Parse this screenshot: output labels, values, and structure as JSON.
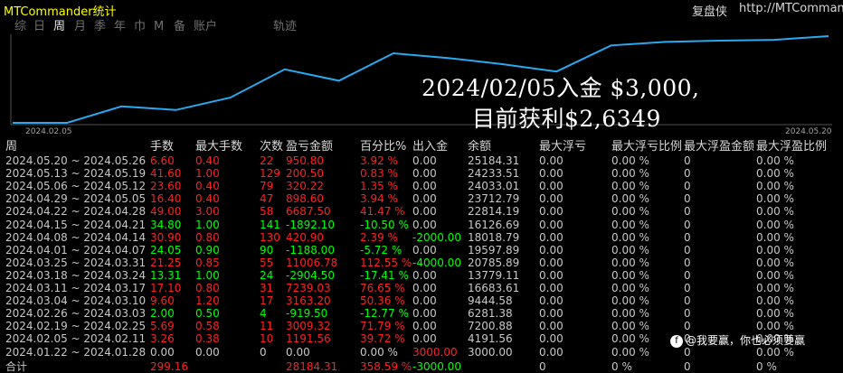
{
  "app": {
    "title": "MTCommander统计",
    "site_name": "复盘侠",
    "site_url": "http://MTCommands"
  },
  "periods": [
    {
      "label": "综",
      "active": false
    },
    {
      "label": "日",
      "active": false
    },
    {
      "label": "周",
      "active": true
    },
    {
      "label": "月",
      "active": false
    },
    {
      "label": "季",
      "active": false
    },
    {
      "label": "年",
      "active": false
    },
    {
      "label": "巾",
      "active": false
    },
    {
      "label": "M",
      "active": false
    },
    {
      "label": "备",
      "active": false
    },
    {
      "label": "账户",
      "active": false
    },
    {
      "label": "轨迹",
      "active": false
    }
  ],
  "overlay": {
    "line1": "2024/02/05入金 $3,000,",
    "line2": "目前获利$2,6349"
  },
  "chart_data": {
    "type": "line",
    "x_labels": [
      "2024.02.05",
      "2024.05.20"
    ],
    "series": [
      {
        "values": [
          3000,
          3000,
          7200.88,
          6281.38,
          9444.58,
          16683.61,
          13779.11,
          20785.89,
          19597.89,
          18018.79,
          16126.69,
          22814.19,
          23712.79,
          24033.01,
          24233.51,
          25184.31
        ]
      }
    ],
    "colors": {
      "line": "#29a9f0",
      "grid": "#2a2a2a",
      "axis": "#505050"
    }
  },
  "table": {
    "headers": [
      "周",
      "手数",
      "最大手数",
      "次数",
      "盈亏金额",
      "百分比%",
      "出入金",
      "余额",
      "最大浮亏",
      "最大浮亏比例",
      "最大浮盈金额",
      "最大浮盈比例"
    ],
    "rows": [
      {
        "period": "2024.05.20 ~ 2024.05.26",
        "lots": "6.60",
        "max_lots": "0.40",
        "count": "22",
        "pnl": "950.80",
        "pct": "3.92 %",
        "flow": "0.00",
        "balance": "25184.31",
        "max_float_loss": "0.00",
        "max_float_loss_pct": "0.00 %",
        "max_float_profit": "0",
        "max_float_profit_pct": "0.00 %",
        "sign": "pos"
      },
      {
        "period": "2024.05.13 ~ 2024.05.19",
        "lots": "41.60",
        "max_lots": "1.00",
        "count": "129",
        "pnl": "200.50",
        "pct": "0.83 %",
        "flow": "0.00",
        "balance": "24233.51",
        "max_float_loss": "0.00",
        "max_float_loss_pct": "0.00 %",
        "max_float_profit": "0",
        "max_float_profit_pct": "0.00 %",
        "sign": "pos"
      },
      {
        "period": "2024.05.06 ~ 2024.05.12",
        "lots": "23.60",
        "max_lots": "0.40",
        "count": "79",
        "pnl": "320.22",
        "pct": "1.35 %",
        "flow": "0.00",
        "balance": "24033.01",
        "max_float_loss": "0.00",
        "max_float_loss_pct": "0.00 %",
        "max_float_profit": "0",
        "max_float_profit_pct": "0.00 %",
        "sign": "pos"
      },
      {
        "period": "2024.04.29 ~ 2024.05.05",
        "lots": "16.40",
        "max_lots": "0.40",
        "count": "47",
        "pnl": "898.60",
        "pct": "3.94 %",
        "flow": "0.00",
        "balance": "23712.79",
        "max_float_loss": "0.00",
        "max_float_loss_pct": "0.00 %",
        "max_float_profit": "0",
        "max_float_profit_pct": "0.00 %",
        "sign": "pos"
      },
      {
        "period": "2024.04.22 ~ 2024.04.28",
        "lots": "49.00",
        "max_lots": "3.00",
        "count": "58",
        "pnl": "6687.50",
        "pct": "41.47 %",
        "flow": "0.00",
        "balance": "22814.19",
        "max_float_loss": "0.00",
        "max_float_loss_pct": "0.00 %",
        "max_float_profit": "0",
        "max_float_profit_pct": "0.00 %",
        "sign": "pos"
      },
      {
        "period": "2024.04.15 ~ 2024.04.21",
        "lots": "34.80",
        "max_lots": "1.00",
        "count": "141",
        "pnl": "-1892.10",
        "pct": "-10.50 %",
        "flow": "0.00",
        "balance": "16126.69",
        "max_float_loss": "0.00",
        "max_float_loss_pct": "0.00 %",
        "max_float_profit": "0",
        "max_float_profit_pct": "0.00 %",
        "sign": "neg"
      },
      {
        "period": "2024.04.08 ~ 2024.04.14",
        "lots": "30.90",
        "max_lots": "0.80",
        "count": "130",
        "pnl": "420.90",
        "pct": "2.39 %",
        "flow": "-2000.00",
        "balance": "18018.79",
        "max_float_loss": "0.00",
        "max_float_loss_pct": "0.00 %",
        "max_float_profit": "0",
        "max_float_profit_pct": "0.00 %",
        "sign": "pos"
      },
      {
        "period": "2024.04.01 ~ 2024.04.07",
        "lots": "24.05",
        "max_lots": "0.90",
        "count": "90",
        "pnl": "-1188.00",
        "pct": "-5.72 %",
        "flow": "0.00",
        "balance": "19597.89",
        "max_float_loss": "0.00",
        "max_float_loss_pct": "0.00 %",
        "max_float_profit": "0",
        "max_float_profit_pct": "0.00 %",
        "sign": "neg"
      },
      {
        "period": "2024.03.25 ~ 2024.03.31",
        "lots": "21.25",
        "max_lots": "0.85",
        "count": "55",
        "pnl": "11006.78",
        "pct": "112.55 %",
        "flow": "-4000.00",
        "balance": "20785.89",
        "max_float_loss": "0.00",
        "max_float_loss_pct": "0.00 %",
        "max_float_profit": "0",
        "max_float_profit_pct": "0.00 %",
        "sign": "pos"
      },
      {
        "period": "2024.03.18 ~ 2024.03.24",
        "lots": "13.31",
        "max_lots": "1.00",
        "count": "24",
        "pnl": "-2904.50",
        "pct": "-17.41 %",
        "flow": "0.00",
        "balance": "13779.11",
        "max_float_loss": "0.00",
        "max_float_loss_pct": "0.00 %",
        "max_float_profit": "0",
        "max_float_profit_pct": "0.00 %",
        "sign": "neg"
      },
      {
        "period": "2024.03.11 ~ 2024.03.17",
        "lots": "17.10",
        "max_lots": "0.80",
        "count": "31",
        "pnl": "7239.03",
        "pct": "76.65 %",
        "flow": "0.00",
        "balance": "16683.61",
        "max_float_loss": "0.00",
        "max_float_loss_pct": "0.00 %",
        "max_float_profit": "0",
        "max_float_profit_pct": "0.00 %",
        "sign": "pos"
      },
      {
        "period": "2024.03.04 ~ 2024.03.10",
        "lots": "9.60",
        "max_lots": "1.20",
        "count": "17",
        "pnl": "3163.20",
        "pct": "50.36 %",
        "flow": "0.00",
        "balance": "9444.58",
        "max_float_loss": "0.00",
        "max_float_loss_pct": "0.00 %",
        "max_float_profit": "0",
        "max_float_profit_pct": "0.00 %",
        "sign": "pos"
      },
      {
        "period": "2024.02.26 ~ 2024.03.03",
        "lots": "2.00",
        "max_lots": "0.50",
        "count": "4",
        "pnl": "-919.50",
        "pct": "-12.77 %",
        "flow": "0.00",
        "balance": "6281.38",
        "max_float_loss": "0.00",
        "max_float_loss_pct": "0.00 %",
        "max_float_profit": "0",
        "max_float_profit_pct": "0.00 %",
        "sign": "neg"
      },
      {
        "period": "2024.02.19 ~ 2024.02.25",
        "lots": "5.69",
        "max_lots": "0.58",
        "count": "11",
        "pnl": "3009.32",
        "pct": "71.79 %",
        "flow": "0.00",
        "balance": "7200.88",
        "max_float_loss": "0.00",
        "max_float_loss_pct": "0.00 %",
        "max_float_profit": "0",
        "max_float_profit_pct": "0.00 %",
        "sign": "pos"
      },
      {
        "period": "2024.02.05 ~ 2024.02.11",
        "lots": "3.26",
        "max_lots": "0.38",
        "count": "10",
        "pnl": "1191.56",
        "pct": "39.72 %",
        "flow": "0.00",
        "balance": "4191.56",
        "max_float_loss": "0.00",
        "max_float_loss_pct": "0.00 %",
        "max_float_profit": "0",
        "max_float_profit_pct": "0.00 %",
        "sign": "pos"
      },
      {
        "period": "2024.01.22 ~ 2024.01.28",
        "lots": "0.00",
        "max_lots": "0.00",
        "count": "0",
        "pnl": "0.00",
        "pct": "0.00 %",
        "flow": "3000.00",
        "balance": "3000.00",
        "max_float_loss": "0.00",
        "max_float_loss_pct": "0.00 %",
        "max_float_profit": "0",
        "max_float_profit_pct": "0.00 %",
        "sign": "zero"
      }
    ],
    "totals": {
      "label": "合计",
      "lots": "299.16",
      "pnl": "28184.31",
      "pct": "358.59 %",
      "flow": "-3000.00",
      "max_float_loss": "0",
      "max_float_loss_pct": "0 %",
      "max_float_profit": "0",
      "max_float_profit_pct": "0 %"
    }
  },
  "watermark": {
    "logo": "f",
    "text": "@我要赢，你也必须要赢"
  },
  "colors": {
    "background": "#000000",
    "title": "#ffff00",
    "positive": "#ff2020",
    "negative": "#00ff00",
    "line": "#29a9f0"
  }
}
